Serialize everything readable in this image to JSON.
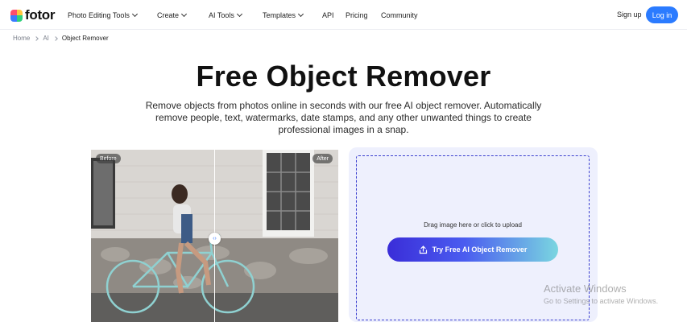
{
  "header": {
    "logo_text": "fotor",
    "nav": [
      {
        "label": "Photo Editing Tools",
        "has_dropdown": true
      },
      {
        "label": "Create",
        "has_dropdown": true
      },
      {
        "label": "AI Tools",
        "has_dropdown": true
      },
      {
        "label": "Templates",
        "has_dropdown": true
      },
      {
        "label": "API",
        "has_dropdown": false
      },
      {
        "label": "Pricing",
        "has_dropdown": false
      },
      {
        "label": "Community",
        "has_dropdown": false
      }
    ],
    "signup_label": "Sign up",
    "login_label": "Log in"
  },
  "breadcrumb": [
    "Home",
    "AI",
    "Object Remover"
  ],
  "hero": {
    "title": "Free Object Remover",
    "subtitle": "Remove objects from photos online in seconds with our free AI object remover. Automatically remove people, text, watermarks, date stamps, and any other unwanted things to create professional images in a snap."
  },
  "compare": {
    "before_label": "Before",
    "after_label": "After",
    "handle_icon": "left-right-arrows-icon"
  },
  "upload": {
    "drag_text": "Drag image here or click to upload",
    "button_label": "Try Free AI Object Remover",
    "button_icon": "upload-icon"
  },
  "watermark": {
    "title": "Activate Windows",
    "subtitle": "Go to Settings to activate Windows."
  },
  "colors": {
    "accent": "#2b7bff",
    "cta_start": "#3a2dd8",
    "cta_end": "#7ad6e0",
    "panel_bg": "#eef0fd"
  }
}
